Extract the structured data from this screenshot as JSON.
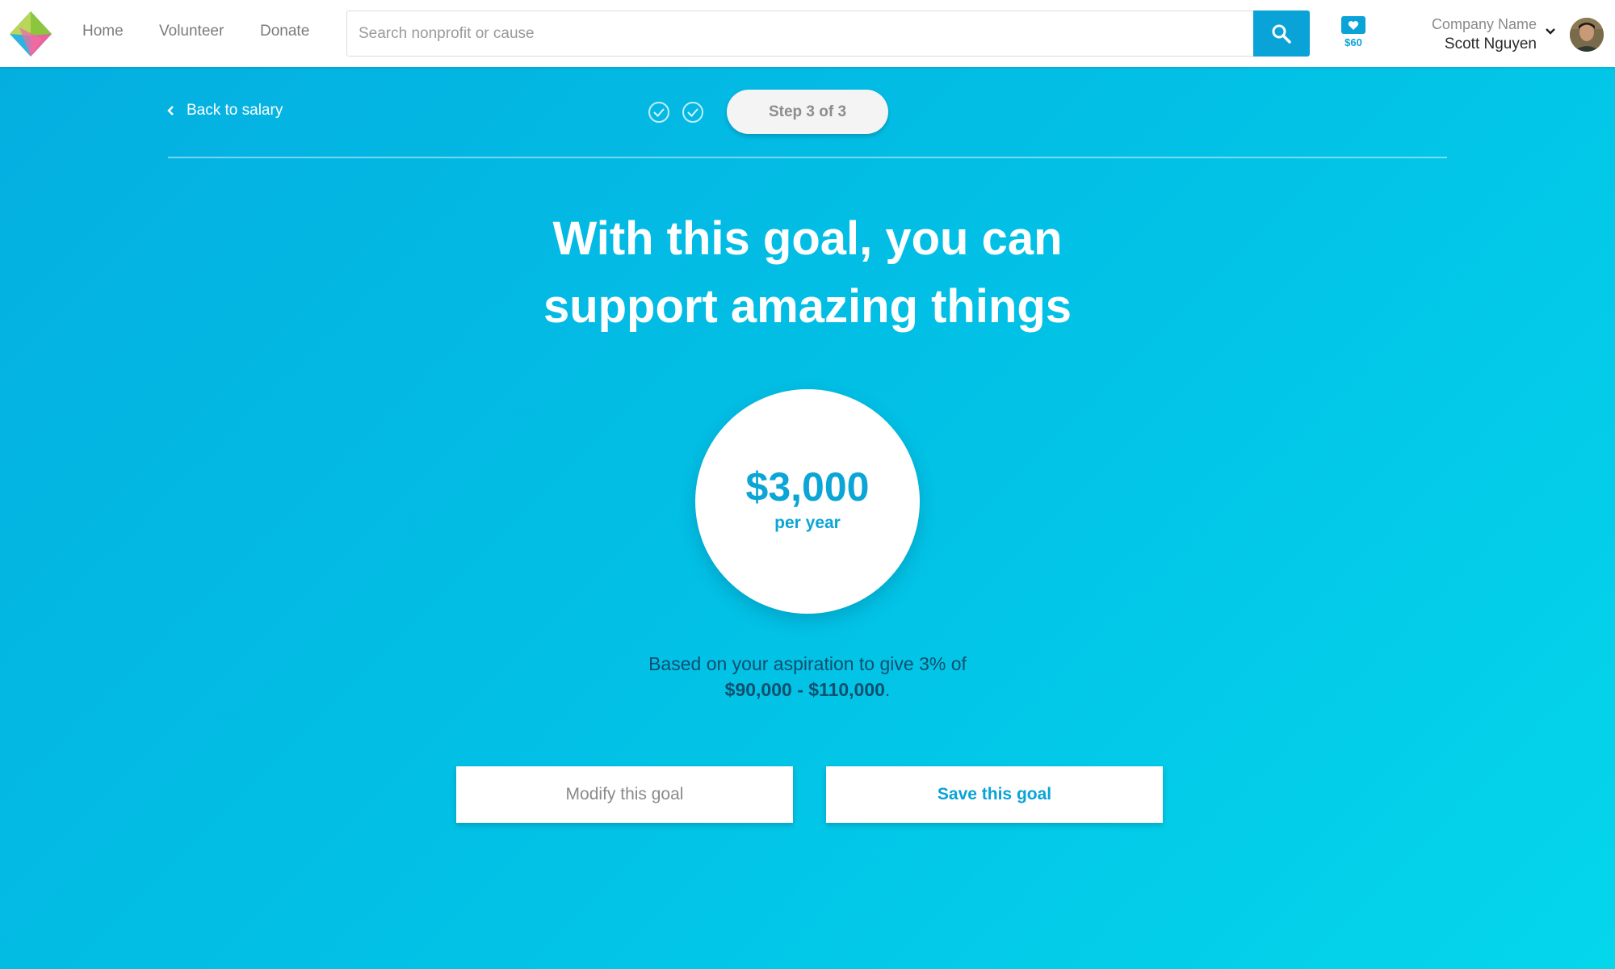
{
  "nav": {
    "home": "Home",
    "volunteer": "Volunteer",
    "donate": "Donate"
  },
  "search": {
    "placeholder": "Search nonprofit or cause",
    "icon": "search-icon"
  },
  "wallet": {
    "icon": "heart-icon",
    "amount": "$60"
  },
  "account": {
    "company": "Company Name",
    "user": "Scott Nguyen"
  },
  "steps": {
    "back_label": "Back to salary",
    "current": "Step 3 of 3",
    "completed_icons": [
      "check-circle-icon",
      "check-circle-icon"
    ]
  },
  "hero": {
    "headline_line1": "With this goal, you can",
    "headline_line2": "support amazing things",
    "amount": "$3,000",
    "period": "per year",
    "basis_line1": "Based on your aspiration to give 3% of",
    "basis_range": "$90,000 - $110,000",
    "basis_end": "."
  },
  "actions": {
    "modify": "Modify this goal",
    "save": "Save this goal"
  },
  "colors": {
    "accent": "#0aa3d8",
    "background_start": "#04aee0",
    "background_end": "#04d6ec"
  }
}
